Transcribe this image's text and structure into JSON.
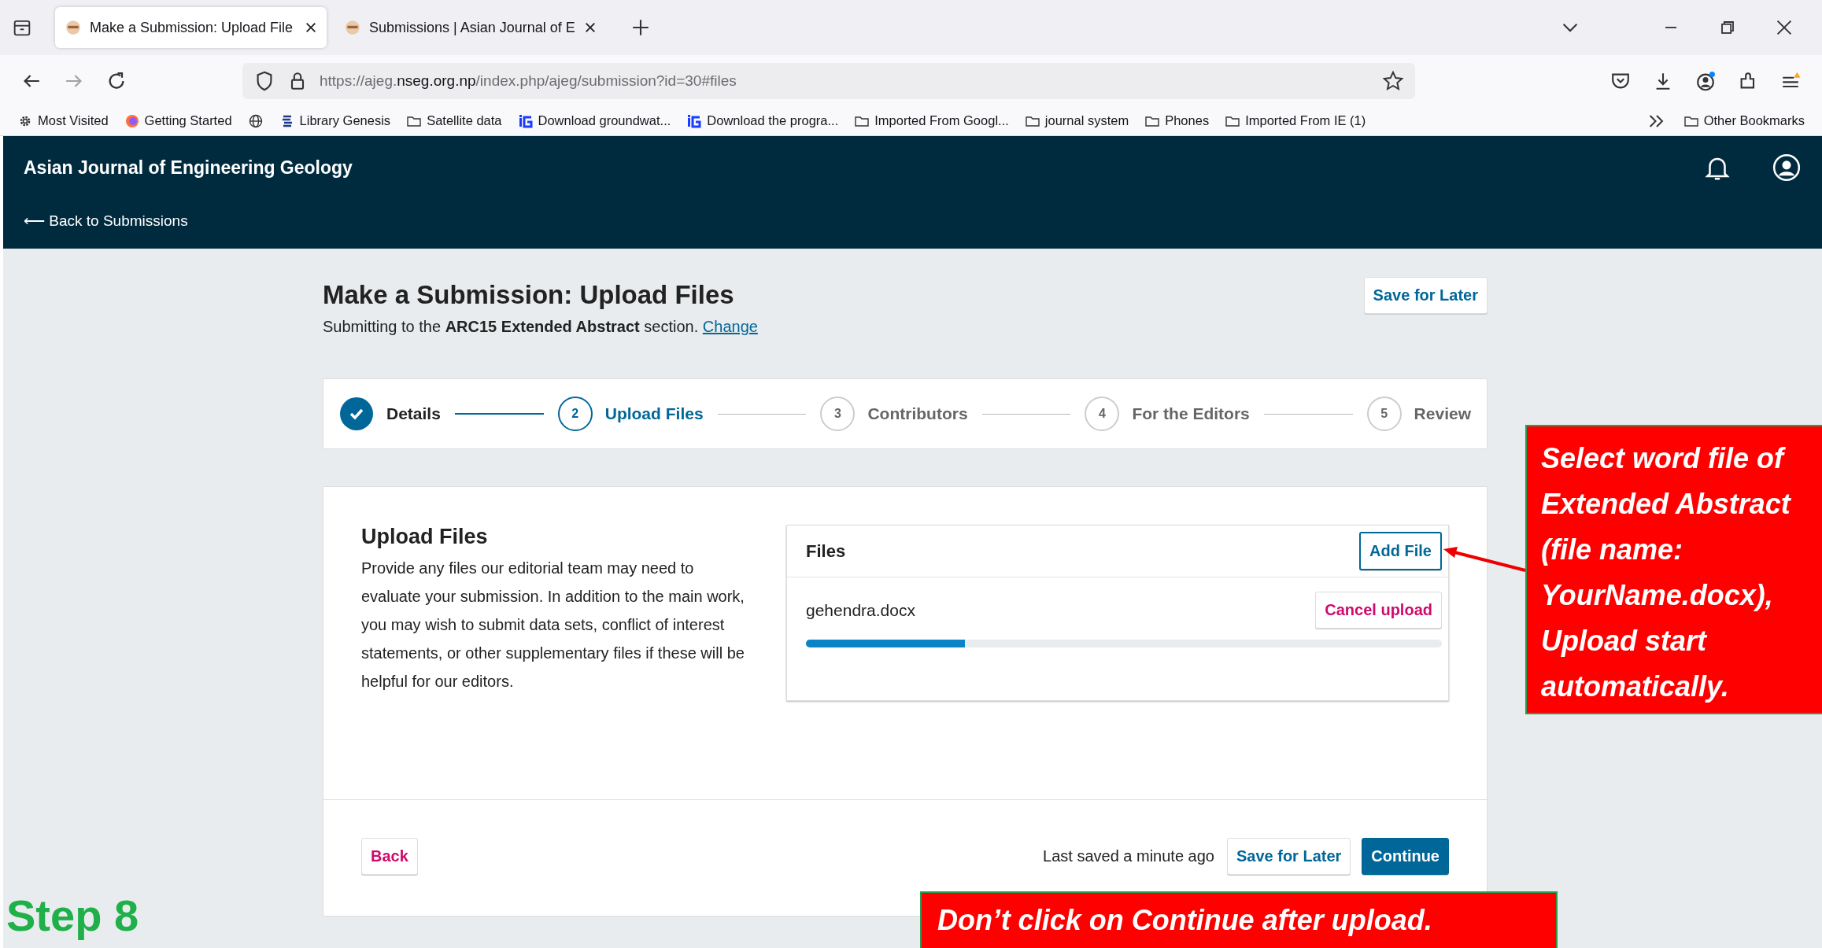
{
  "browser": {
    "tabs": [
      {
        "title": "Make a Submission: Upload File",
        "selected": true
      },
      {
        "title": "Submissions | Asian Journal of E",
        "selected": false
      }
    ],
    "url": {
      "host_before": "https://ajeg.",
      "host_main": "nseg.org.np",
      "path": "/index.php/ajeg/submission?id=30#files"
    },
    "bookmarks": [
      {
        "kind": "gear",
        "label": "Most Visited"
      },
      {
        "kind": "firefox",
        "label": "Getting Started"
      },
      {
        "kind": "globe"
      },
      {
        "kind": "book",
        "label": "Library Genesis"
      },
      {
        "kind": "folder",
        "label": "Satellite data"
      },
      {
        "kind": "ig",
        "label": "Download groundwat..."
      },
      {
        "kind": "ig",
        "label": "Download the progra..."
      },
      {
        "kind": "folder",
        "label": "Imported From Googl..."
      },
      {
        "kind": "folder",
        "label": "journal system"
      },
      {
        "kind": "folder",
        "label": "Phones"
      },
      {
        "kind": "folder",
        "label": "Imported From IE (1)"
      }
    ],
    "other_bookmarks": "Other Bookmarks"
  },
  "header": {
    "site_title": "Asian Journal of Engineering Geology",
    "back_link": "⟵ Back to Submissions"
  },
  "page": {
    "title": "Make a Submission: Upload Files",
    "save_button": "Save for Later",
    "subtitle": "Submitting to the **ARC15 Extended Abstract** section.",
    "change_link": "Change"
  },
  "steps": [
    {
      "label": "Details",
      "kind": "complete"
    },
    {
      "number": "2",
      "label": "Upload Files",
      "kind": "current"
    },
    {
      "number": "3",
      "label": "Contributors",
      "kind": "pending"
    },
    {
      "number": "4",
      "label": "For the Editors",
      "kind": "pending"
    },
    {
      "number": "5",
      "label": "Review",
      "kind": "pending"
    }
  ],
  "upload": {
    "heading": "Upload Files",
    "description": "Provide any files our editorial team may need to evaluate your submission. In addition to the main work, you may wish to submit data sets, conflict of interest statements, or other supplementary files if these will be helpful for our editors.",
    "files_panel": {
      "title": "Files",
      "add_button": "Add File",
      "files": [
        {
          "name": "gehendra.docx",
          "cancel_button": "Cancel upload",
          "level": 0.25
        }
      ]
    }
  },
  "footer": {
    "back_button": "Back",
    "last_saved": "Last saved a minute ago",
    "save_button": "Save for Later",
    "continue_button": "Continue"
  },
  "annotations": {
    "callout": "Select word file of Extended Abstract (file name: YourName.docx), Upload start automatically.",
    "warning": "Don’t click on Continue after upload.",
    "step_label": "Step 8"
  }
}
